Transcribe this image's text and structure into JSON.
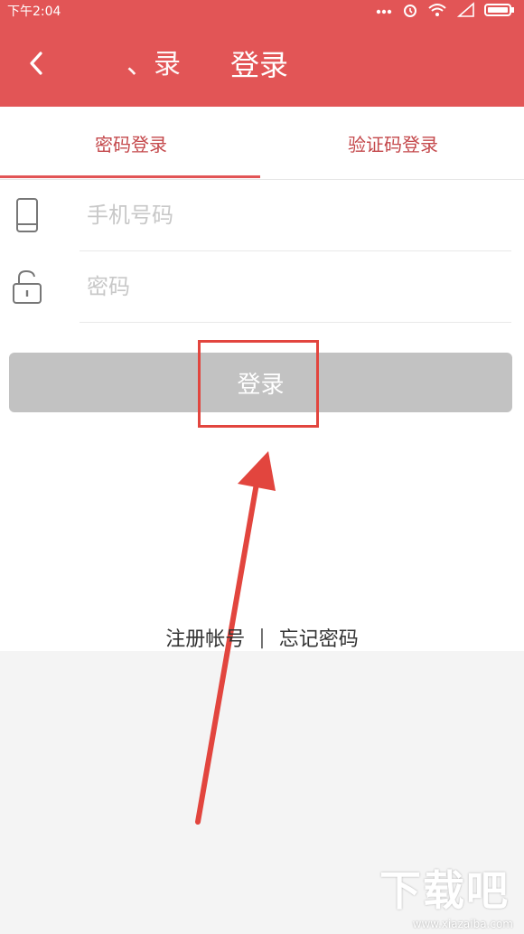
{
  "status_bar": {
    "time": "下午2:04"
  },
  "app_bar": {
    "faded_title": "、录",
    "title": "登录"
  },
  "tabs": [
    {
      "label": "密码登录",
      "active": true
    },
    {
      "label": "验证码登录",
      "active": false
    }
  ],
  "form": {
    "phone_placeholder": "手机号码",
    "password_placeholder": "密码",
    "login_label": "登录"
  },
  "links": {
    "register": "注册帐号",
    "separator": "|",
    "forgot": "忘记密码"
  },
  "watermark": {
    "logo": "下载吧",
    "url": "www.xiazaiba.com"
  },
  "colors": {
    "brand": "#e25556",
    "tab_text": "#c4484b",
    "button_disabled": "#c2c2c2",
    "annotation": "#e2453e"
  },
  "icons": {
    "back": "chevron-left-icon",
    "phone": "mobile-phone-icon",
    "lock": "padlock-icon",
    "wifi": "wifi-icon",
    "battery": "battery-icon"
  }
}
